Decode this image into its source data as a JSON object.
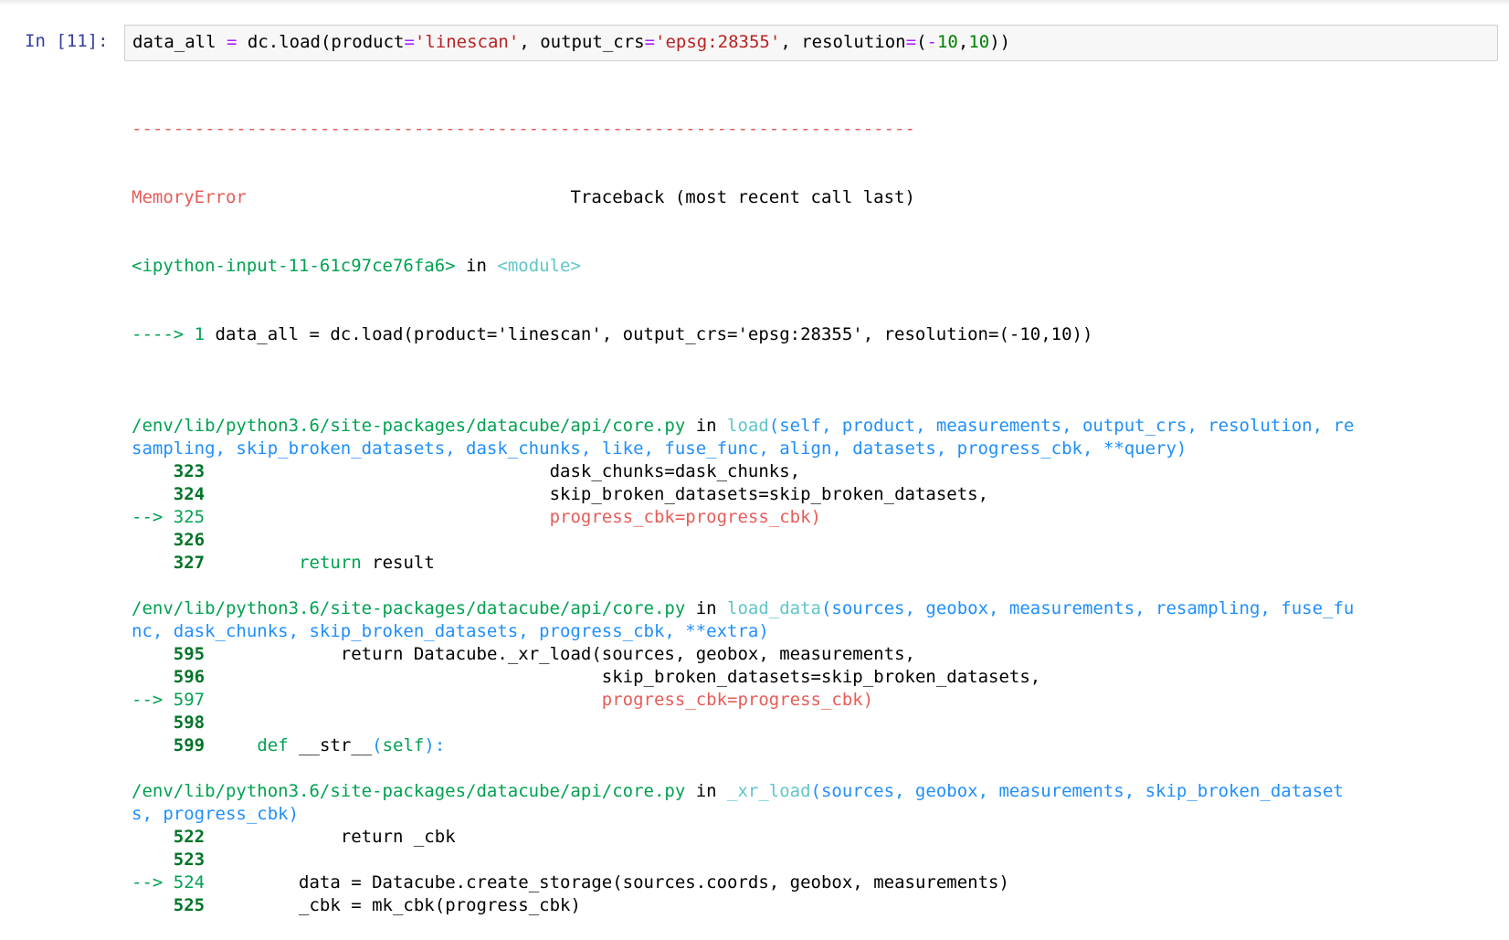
{
  "cell": {
    "prompt": "In [11]:",
    "input_code": {
      "var": "data_all",
      "eq": "=",
      "call": "dc.load(",
      "arg1_name": "product",
      "arg1_val": "'linescan'",
      "sep1": ", ",
      "arg2_name": "output_crs",
      "arg2_val": "'epsg:28355'",
      "sep2": ", ",
      "arg3_name": "resolution",
      "arg3_open": "(",
      "minus": "-",
      "num1": "10",
      "comma": ",",
      "num2": "10",
      "close": "))"
    }
  },
  "traceback": {
    "dashes": "---------------------------------------------------------------------------",
    "error_name": "MemoryError",
    "header_pad": "                               ",
    "header_right": "Traceback (most recent call last)",
    "input_ref": "<ipython-input-11-61c97ce76fa6>",
    "in_word": " in ",
    "module": "<module>",
    "arrow_line_prefix": "----> 1 ",
    "arrow_line_code": "data_all = dc.load(product='linescan', output_crs='epsg:28355', resolution=(-10,10))",
    "frames": [
      {
        "path": "/env/lib/python3.6/site-packages/datacube/api/core.py",
        "in_word": " in ",
        "func": "load",
        "sig1": "(self, product, measurements, output_crs, resolution, re",
        "sig2": "sampling, skip_broken_datasets, dask_chunks, like, fuse_func, align, datasets, progress_cbk, **query)",
        "lines": [
          {
            "prefix": "    ",
            "num": "323",
            "code": "                                dask_chunks=dask_chunks,",
            "cls": ""
          },
          {
            "prefix": "    ",
            "num": "324",
            "code": "                                skip_broken_datasets=skip_broken_datasets,",
            "cls": ""
          },
          {
            "prefix": "--> ",
            "num": "325",
            "code": "                                progress_cbk=progress_cbk)",
            "cls": "red"
          },
          {
            "prefix": "    ",
            "num": "326",
            "code": "",
            "cls": ""
          },
          {
            "prefix": "    ",
            "num": "327",
            "code": "        return result",
            "cls": "ret"
          }
        ]
      },
      {
        "path": "/env/lib/python3.6/site-packages/datacube/api/core.py",
        "in_word": " in ",
        "func": "load_data",
        "sig1": "(sources, geobox, measurements, resampling, fuse_fu",
        "sig2": "nc, dask_chunks, skip_broken_datasets, progress_cbk, **extra)",
        "lines": [
          {
            "prefix": "    ",
            "num": "595",
            "code": "            return Datacube._xr_load(sources, geobox, measurements,",
            "cls": ""
          },
          {
            "prefix": "    ",
            "num": "596",
            "code": "                                     skip_broken_datasets=skip_broken_datasets,",
            "cls": ""
          },
          {
            "prefix": "--> ",
            "num": "597",
            "code": "                                     progress_cbk=progress_cbk)",
            "cls": "red"
          },
          {
            "prefix": "    ",
            "num": "598",
            "code": "",
            "cls": ""
          },
          {
            "prefix": "    ",
            "num": "599",
            "code": "    def __str__(self):",
            "cls": "def"
          }
        ]
      },
      {
        "path": "/env/lib/python3.6/site-packages/datacube/api/core.py",
        "in_word": " in ",
        "func": "_xr_load",
        "sig1": "(sources, geobox, measurements, skip_broken_dataset",
        "sig2": "s, progress_cbk)",
        "lines": [
          {
            "prefix": "    ",
            "num": "522",
            "code": "            return _cbk",
            "cls": ""
          },
          {
            "prefix": "    ",
            "num": "523",
            "code": "",
            "cls": ""
          },
          {
            "prefix": "--> ",
            "num": "524",
            "code": "        data = Datacube.create_storage(sources.coords, geobox, measurements)",
            "cls": ""
          },
          {
            "prefix": "    ",
            "num": "525",
            "code": "        _cbk = mk_cbk(progress_cbk)",
            "cls": ""
          }
        ]
      }
    ]
  }
}
